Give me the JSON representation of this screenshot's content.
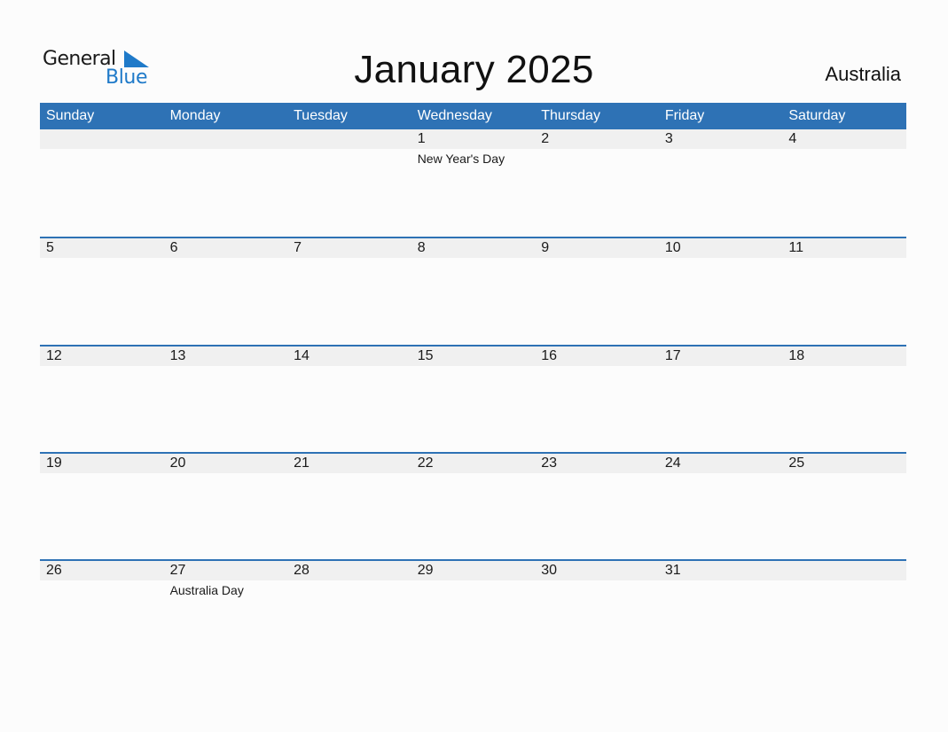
{
  "logo": {
    "line1": "General",
    "line2": "Blue",
    "brand_color": "#1f7ac9"
  },
  "title": "January 2025",
  "country": "Australia",
  "colors": {
    "header_bg": "#2e72b5",
    "header_text": "#ffffff",
    "day_bar_bg": "#f0f0f0",
    "week_border": "#2e72b5"
  },
  "weekdays": [
    "Sunday",
    "Monday",
    "Tuesday",
    "Wednesday",
    "Thursday",
    "Friday",
    "Saturday"
  ],
  "weeks": [
    {
      "days": [
        "",
        "",
        "",
        "1",
        "2",
        "3",
        "4"
      ],
      "events": [
        "",
        "",
        "",
        "New Year's Day",
        "",
        "",
        ""
      ]
    },
    {
      "days": [
        "5",
        "6",
        "7",
        "8",
        "9",
        "10",
        "11"
      ],
      "events": [
        "",
        "",
        "",
        "",
        "",
        "",
        ""
      ]
    },
    {
      "days": [
        "12",
        "13",
        "14",
        "15",
        "16",
        "17",
        "18"
      ],
      "events": [
        "",
        "",
        "",
        "",
        "",
        "",
        ""
      ]
    },
    {
      "days": [
        "19",
        "20",
        "21",
        "22",
        "23",
        "24",
        "25"
      ],
      "events": [
        "",
        "",
        "",
        "",
        "",
        "",
        ""
      ]
    },
    {
      "days": [
        "26",
        "27",
        "28",
        "29",
        "30",
        "31",
        ""
      ],
      "events": [
        "",
        "Australia Day",
        "",
        "",
        "",
        "",
        ""
      ]
    }
  ]
}
